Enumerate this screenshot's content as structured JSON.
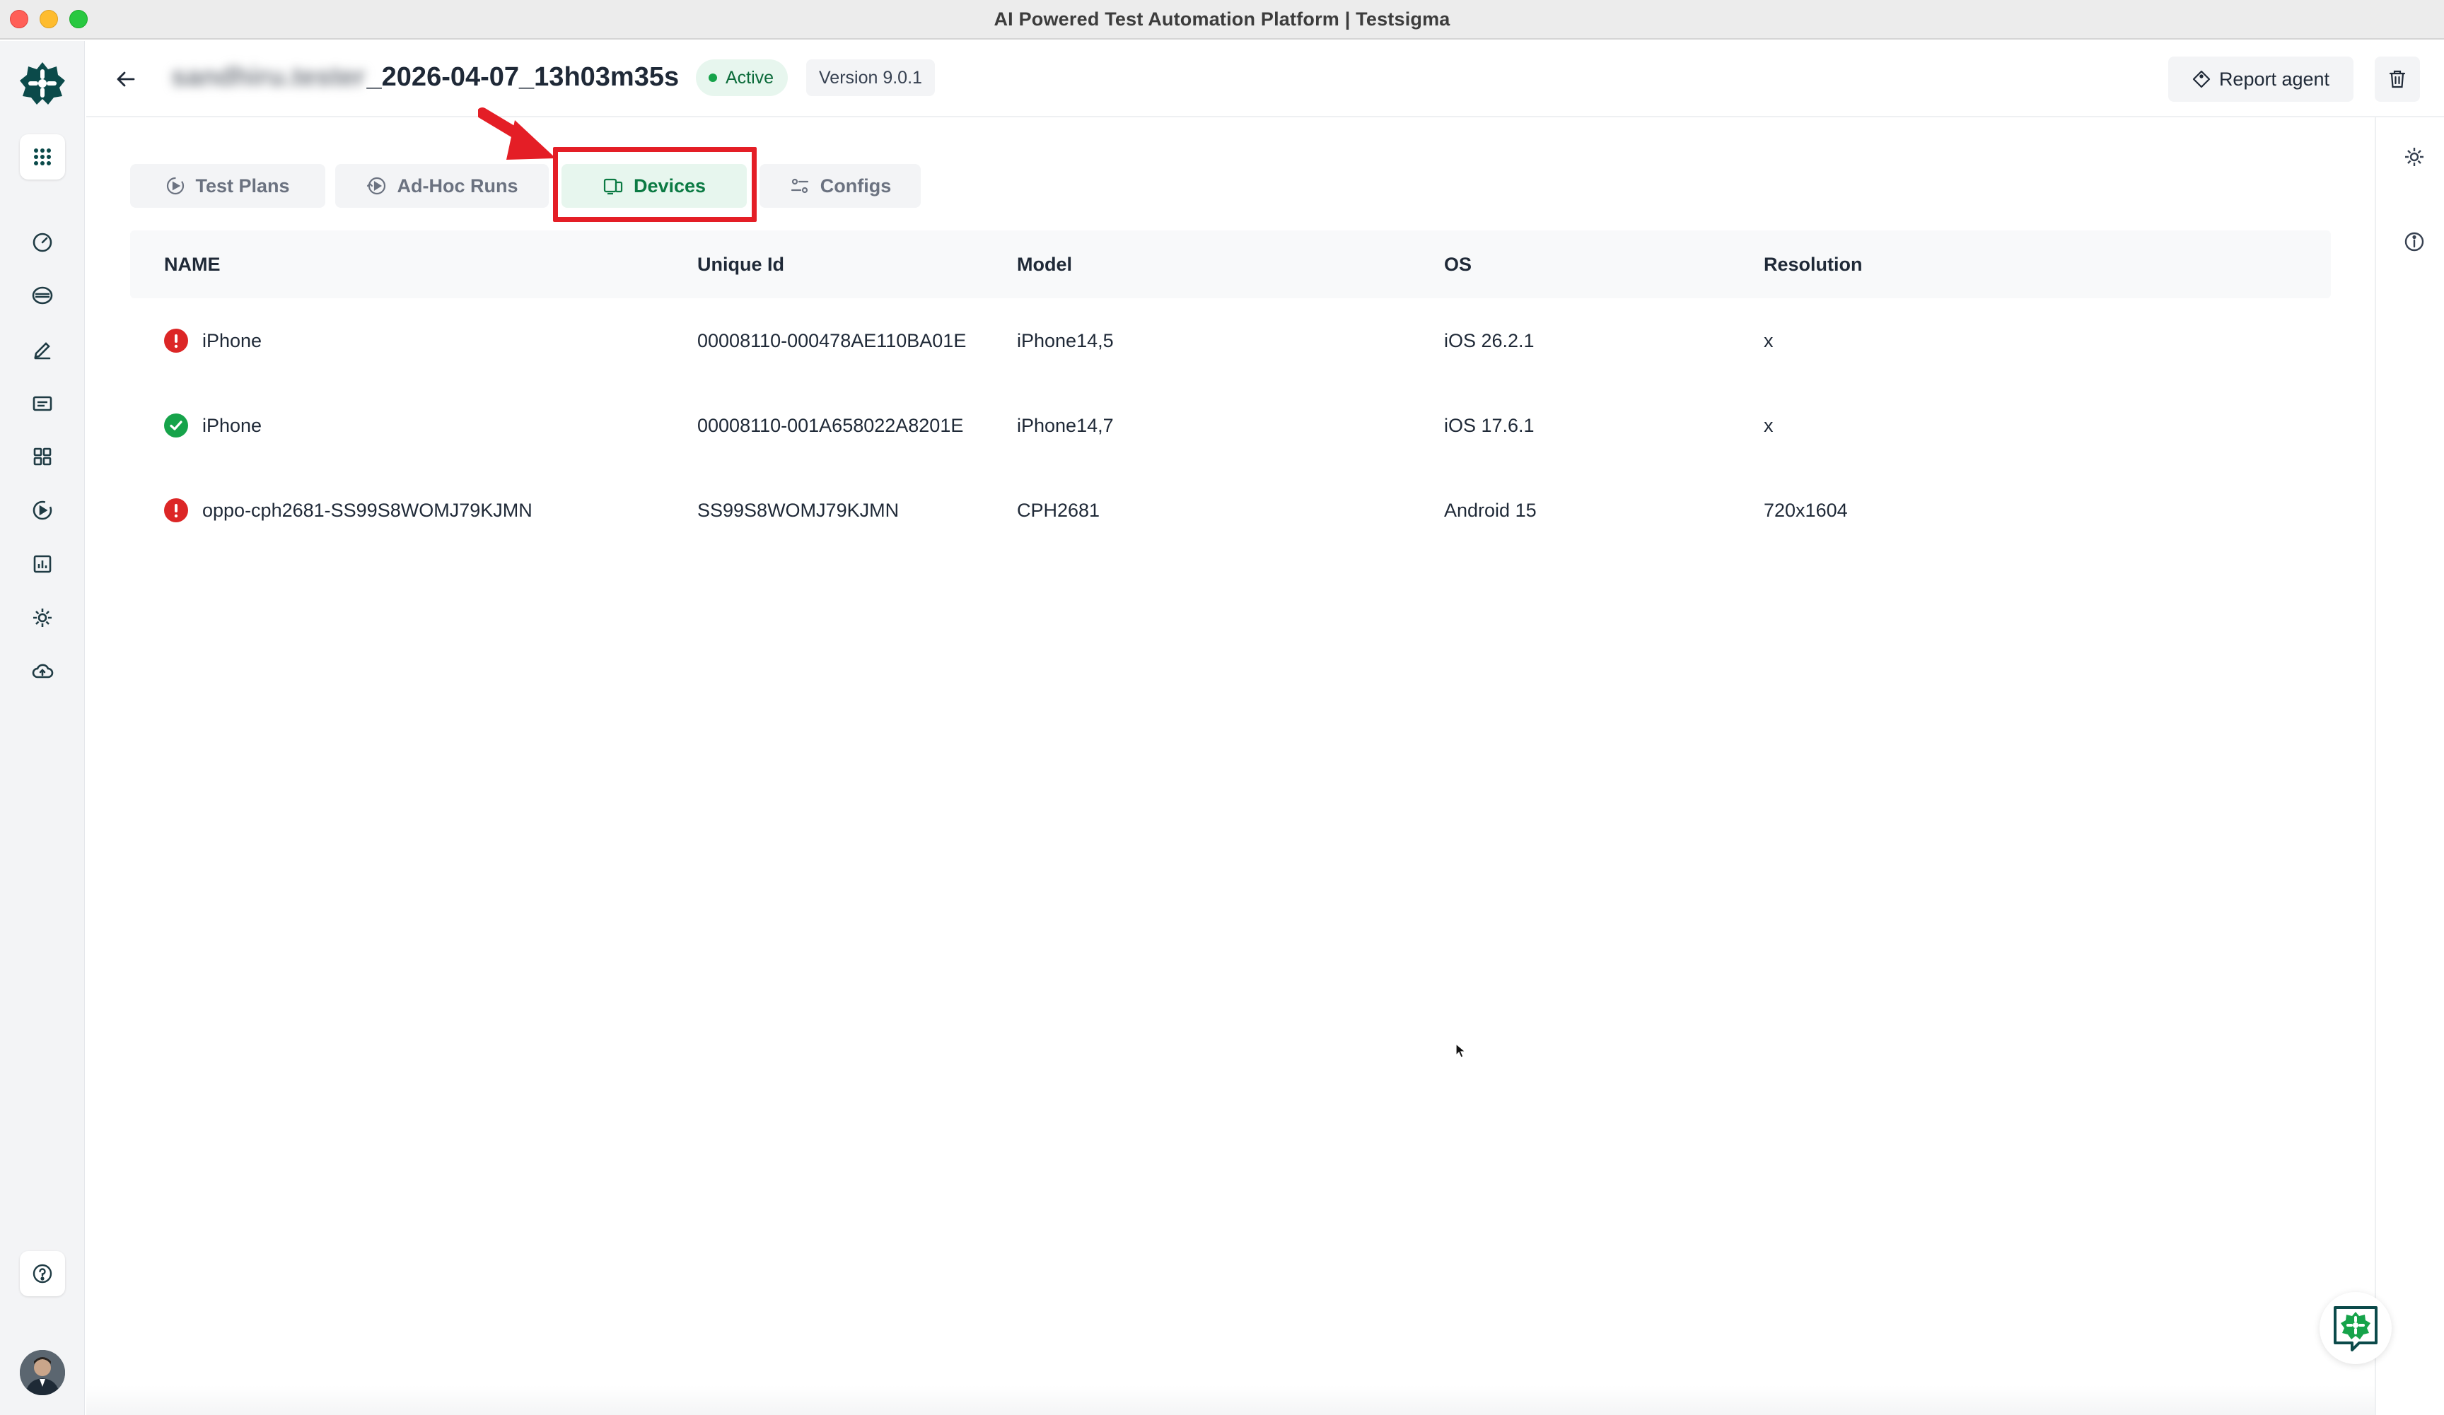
{
  "window": {
    "title": "AI Powered Test Automation Platform | Testsigma"
  },
  "header": {
    "title_blurred": "sandhiru.tester",
    "title_suffix": "_2026-04-07_13h03m35s",
    "status": "Active",
    "version": "Version 9.0.1",
    "report_agent_label": "Report agent"
  },
  "tabs": [
    {
      "label": "Test Plans",
      "icon": "test-plans-icon",
      "active": false
    },
    {
      "label": "Ad-Hoc Runs",
      "icon": "adhoc-runs-icon",
      "active": false
    },
    {
      "label": "Devices",
      "icon": "devices-icon",
      "active": true
    },
    {
      "label": "Configs",
      "icon": "configs-icon",
      "active": false
    }
  ],
  "table": {
    "columns": [
      "NAME",
      "Unique Id",
      "Model",
      "OS",
      "Resolution"
    ],
    "rows": [
      {
        "status": "error",
        "name": "iPhone",
        "unique_id": "00008110-000478AE110BA01E",
        "model": "iPhone14,5",
        "os": "iOS 26.2.1",
        "resolution": "x"
      },
      {
        "status": "ok",
        "name": "iPhone",
        "unique_id": "00008110-001A658022A8201E",
        "model": "iPhone14,7",
        "os": "iOS 17.6.1",
        "resolution": "x"
      },
      {
        "status": "error",
        "name": "oppo-cph2681-SS99S8WOMJ79KJMN",
        "unique_id": "SS99S8WOMJ79KJMN",
        "model": "CPH2681",
        "os": "Android 15",
        "resolution": "720x1604"
      }
    ]
  },
  "colors": {
    "brand": "#0b4a4a",
    "active_green": "#0b7a43",
    "error_red": "#dc2626",
    "ok_green": "#16a34a",
    "highlight_red": "#e41e26"
  }
}
